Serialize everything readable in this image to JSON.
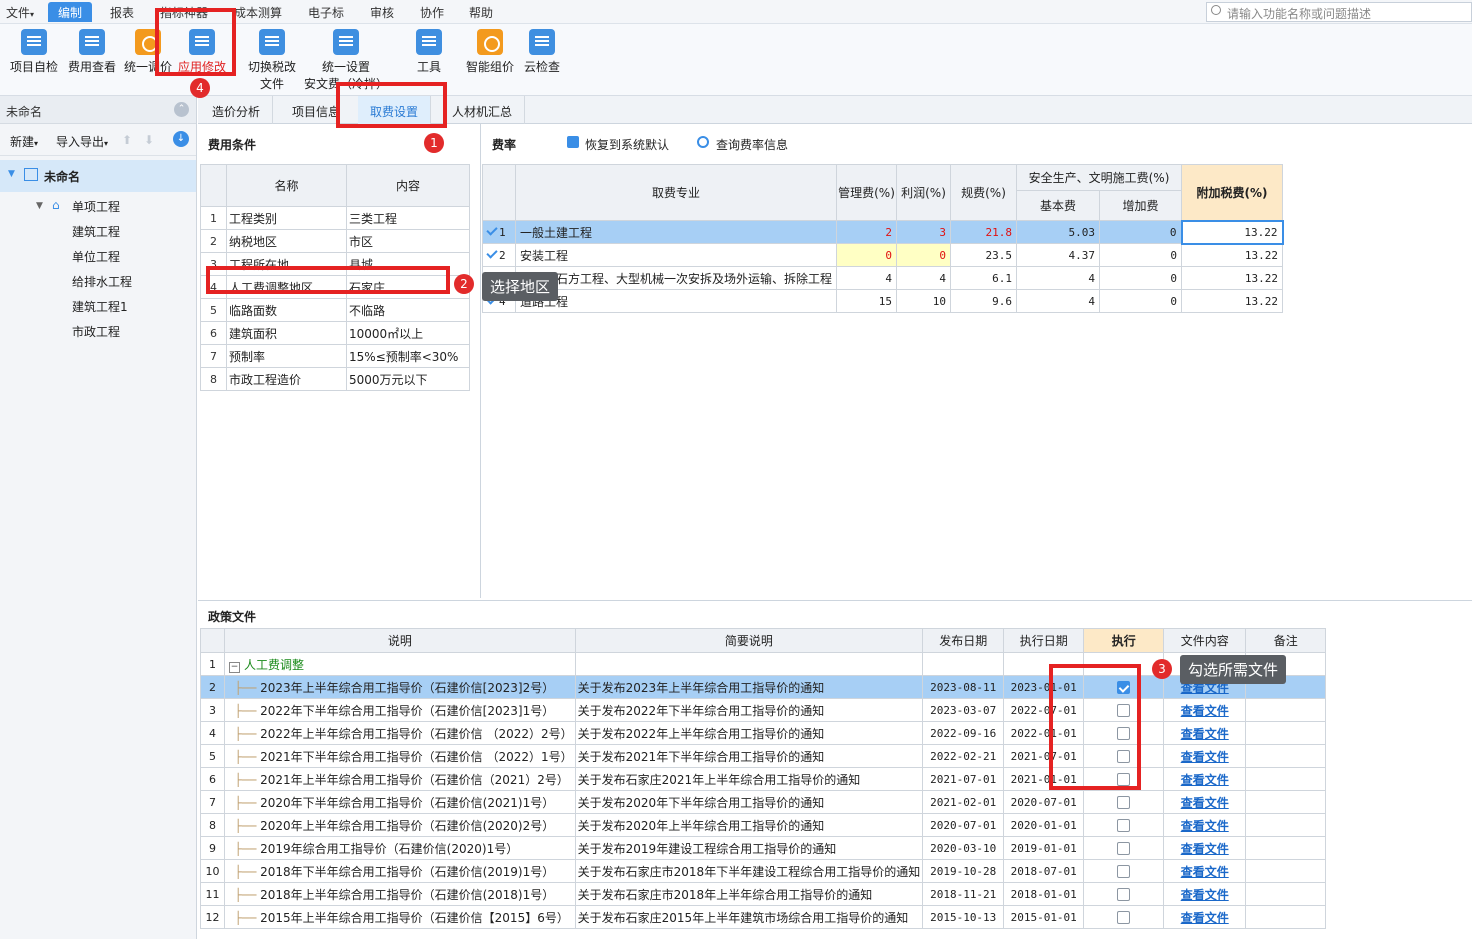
{
  "menu": {
    "items": [
      "文件",
      "编制",
      "报表",
      "指标神器",
      "成本测算",
      "电子标",
      "审核",
      "协作",
      "帮助"
    ],
    "active": "编制",
    "search_placeholder": "请输入功能名称或问题描述"
  },
  "toolbar": {
    "buttons": [
      {
        "label1": "项目自检",
        "label2": "",
        "icon": "check-doc-icon"
      },
      {
        "label1": "费用查看",
        "label2": "",
        "icon": "fee-view-icon"
      },
      {
        "label1": "统一调价",
        "label2": "",
        "icon": "price-adjust-icon"
      },
      {
        "label1": "应用修改",
        "label2": "",
        "icon": "apply-edit-icon"
      },
      {
        "label1": "切换税改",
        "label2": "文件",
        "icon": "tax-switch-icon"
      },
      {
        "label1": "统一设置",
        "label2": "安文费（冷拌）",
        "icon": "unified-setting-icon"
      },
      {
        "label1": "工具",
        "label2": "",
        "icon": "tool-icon"
      },
      {
        "label1": "智能组价",
        "label2": "",
        "icon": "smart-price-icon"
      },
      {
        "label1": "云检查",
        "label2": "",
        "icon": "cloud-check-icon"
      }
    ]
  },
  "left": {
    "header": "未命名",
    "new_label": "新建",
    "import_label": "导入导出",
    "root": "未命名",
    "single": "单项工程",
    "units": [
      "建筑工程",
      "单位工程",
      "给排水工程",
      "建筑工程1",
      "市政工程"
    ]
  },
  "tabs": [
    "造价分析",
    "项目信息",
    "取费设置",
    "人材机汇总"
  ],
  "fee_conditions": {
    "title": "费用条件",
    "col_name": "名称",
    "col_content": "内容",
    "rows": [
      {
        "n": "1",
        "name": "工程类别",
        "content": "三类工程"
      },
      {
        "n": "2",
        "name": "纳税地区",
        "content": "市区"
      },
      {
        "n": "3",
        "name": "工程所在地",
        "content": "县城"
      },
      {
        "n": "4",
        "name": "人工费调整地区",
        "content": "石家庄"
      },
      {
        "n": "5",
        "name": "临路面数",
        "content": "不临路"
      },
      {
        "n": "6",
        "name": "建筑面积",
        "content": "10000㎡以上"
      },
      {
        "n": "7",
        "name": "预制率",
        "content": "15%≤预制率<30%"
      },
      {
        "n": "8",
        "name": "市政工程造价",
        "content": "5000万元以下"
      }
    ]
  },
  "rates": {
    "title": "费率",
    "restore": "恢复到系统默认",
    "query": "查询费率信息",
    "h_major": "取费专业",
    "h_mgmt": "管理费(%)",
    "h_profit": "利润(%)",
    "h_reg": "规费(%)",
    "h_safety": "安全生产、文明施工费(%)",
    "h_basic": "基本费",
    "h_extra": "增加费",
    "h_tax": "附加税费(%)",
    "rows": [
      {
        "n": "1",
        "name": "一般土建工程",
        "mgmt": "2",
        "profit": "3",
        "reg": "21.8",
        "basic": "5.03",
        "extra": "0",
        "tax": "13.22"
      },
      {
        "n": "2",
        "name": "安装工程",
        "mgmt": "0",
        "profit": "0",
        "reg": "23.5",
        "basic": "4.37",
        "extra": "0",
        "tax": "13.22"
      },
      {
        "n": "3",
        "name": "市政土石方工程、大型机械一次安拆及场外运输、拆除工程",
        "mgmt": "4",
        "profit": "4",
        "reg": "6.1",
        "basic": "4",
        "extra": "0",
        "tax": "13.22"
      },
      {
        "n": "4",
        "name": "道路工程",
        "mgmt": "15",
        "profit": "10",
        "reg": "9.6",
        "basic": "4",
        "extra": "0",
        "tax": "13.22"
      }
    ]
  },
  "policy": {
    "title": "政策文件",
    "h_desc": "说明",
    "h_brief": "简要说明",
    "h_pub": "发布日期",
    "h_exec_date": "执行日期",
    "h_exec": "执行",
    "h_file": "文件内容",
    "h_note": "备注",
    "group": "人工费调整",
    "rows": [
      {
        "n": "2",
        "desc": "2023年上半年综合用工指导价（石建价信[2023]2号）",
        "brief": "关于发布2023年上半年综合用工指导价的通知",
        "pub": "2023-08-11",
        "exec": "2023-01-01",
        "checked": true,
        "file": "查看文件"
      },
      {
        "n": "3",
        "desc": "2022年下半年综合用工指导价（石建价信[2023]1号）",
        "brief": "关于发布2022年下半年综合用工指导价的通知",
        "pub": "2023-03-07",
        "exec": "2022-07-01",
        "checked": false,
        "file": "查看文件"
      },
      {
        "n": "4",
        "desc": "2022年上半年综合用工指导价（石建价信 （2022）2号）",
        "brief": "关于发布2022年上半年综合用工指导价的通知",
        "pub": "2022-09-16",
        "exec": "2022-01-01",
        "checked": false,
        "file": "查看文件"
      },
      {
        "n": "5",
        "desc": "2021年下半年综合用工指导价（石建价信 （2022）1号）",
        "brief": "关于发布2021年下半年综合用工指导价的通知",
        "pub": "2022-02-21",
        "exec": "2021-07-01",
        "checked": false,
        "file": "查看文件"
      },
      {
        "n": "6",
        "desc": "2021年上半年综合用工指导价（石建价信（2021）2号）",
        "brief": "关于发布石家庄2021年上半年综合用工指导价的通知",
        "pub": "2021-07-01",
        "exec": "2021-01-01",
        "checked": false,
        "file": "查看文件"
      },
      {
        "n": "7",
        "desc": "2020年下半年综合用工指导价（石建价信(2021)1号）",
        "brief": "关于发布2020年下半年综合用工指导价的通知",
        "pub": "2021-02-01",
        "exec": "2020-07-01",
        "checked": false,
        "file": "查看文件"
      },
      {
        "n": "8",
        "desc": "2020年上半年综合用工指导价（石建价信(2020)2号）",
        "brief": "关于发布2020年上半年综合用工指导价的通知",
        "pub": "2020-07-01",
        "exec": "2020-01-01",
        "checked": false,
        "file": "查看文件"
      },
      {
        "n": "9",
        "desc": "2019年综合用工指导价（石建价信(2020)1号）",
        "brief": "关于发布2019年建设工程综合用工指导价的通知",
        "pub": "2020-03-10",
        "exec": "2019-01-01",
        "checked": false,
        "file": "查看文件"
      },
      {
        "n": "10",
        "desc": "2018年下半年综合用工指导价（石建价信(2019)1号）",
        "brief": "关于发布石家庄市2018年下半年建设工程综合用工指导价的通知",
        "pub": "2019-10-28",
        "exec": "2018-07-01",
        "checked": false,
        "file": "查看文件"
      },
      {
        "n": "11",
        "desc": "2018年上半年综合用工指导价（石建价信(2018)1号）",
        "brief": "关于发布石家庄市2018年上半年综合用工指导价的通知",
        "pub": "2018-11-21",
        "exec": "2018-01-01",
        "checked": false,
        "file": "查看文件"
      },
      {
        "n": "12",
        "desc": "2015年上半年综合用工指导价（石建价信【2015】6号）",
        "brief": "关于发布石家庄2015年上半年建筑市场综合用工指导价的通知",
        "pub": "2015-10-13",
        "exec": "2015-01-01",
        "checked": false,
        "file": "查看文件"
      }
    ]
  },
  "annotations": {
    "b1": "1",
    "b2": "2",
    "b3": "3",
    "b4": "4",
    "tip2": "选择地区",
    "tip3": "勾选所需文件"
  },
  "colors": {
    "accent": "#3a8ee6",
    "annotation": "#e52222",
    "selected_row": "#a7cff5"
  }
}
